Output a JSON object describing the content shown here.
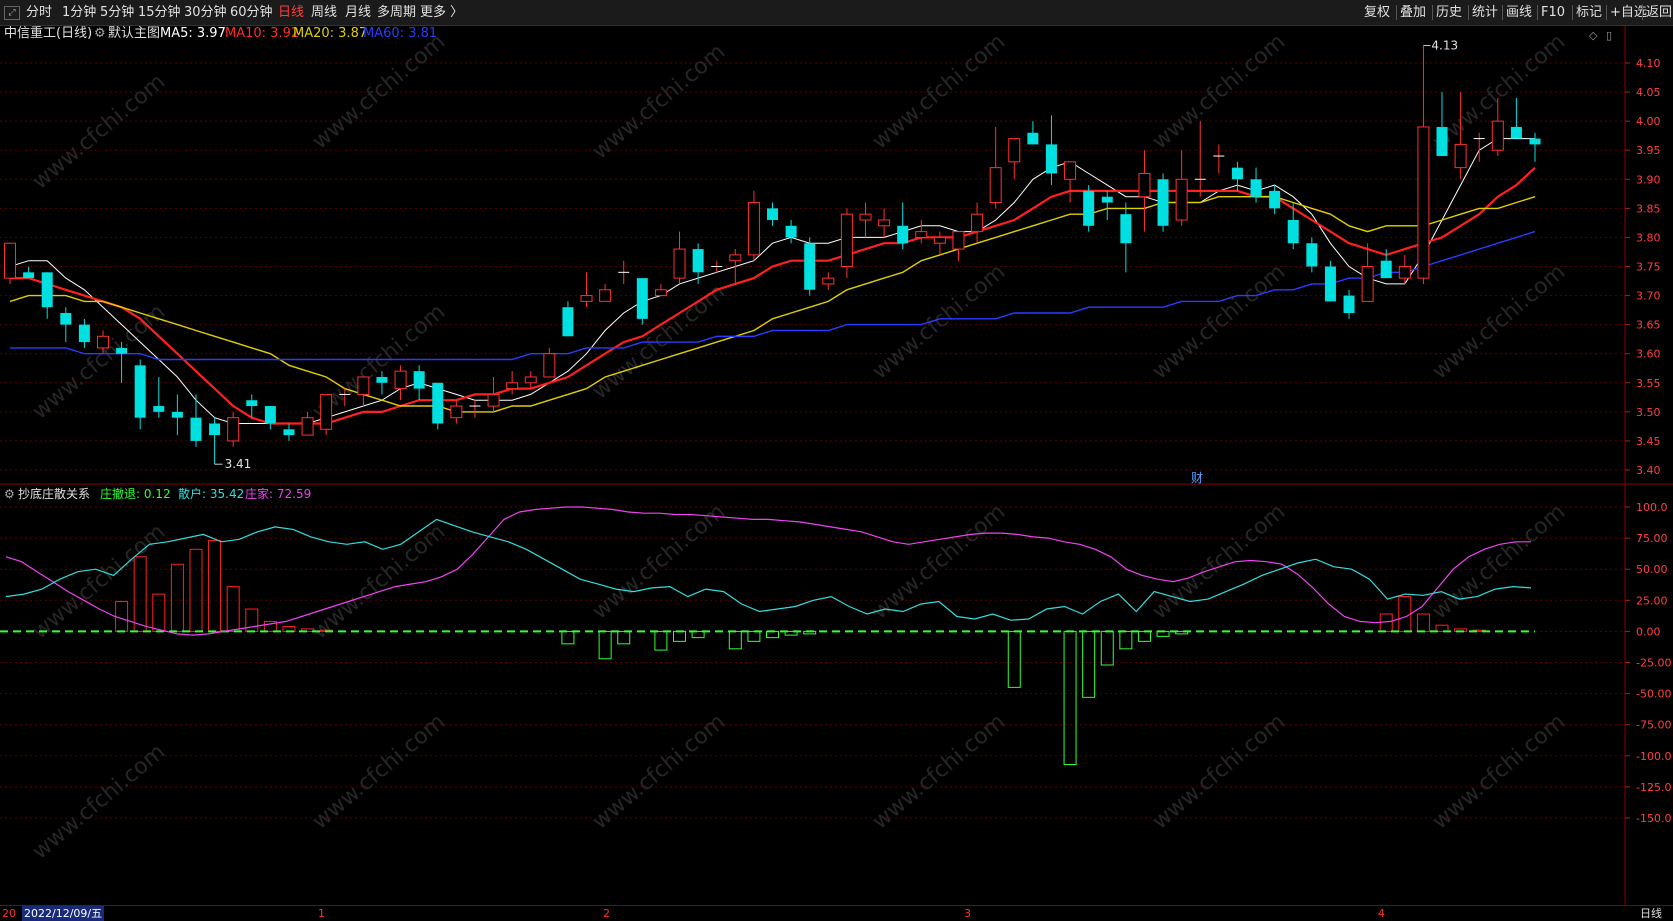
{
  "toolbar": {
    "left_items": [
      "分时",
      "1分钟",
      "5分钟",
      "15分钟",
      "30分钟",
      "60分钟",
      "日线",
      "周线",
      "月线",
      "多周期",
      "更多 〉"
    ],
    "active_index": 6,
    "right_items": [
      "复权",
      "叠加",
      "历史",
      "统计",
      "画线",
      "F10",
      "标记",
      "+自选",
      "返回"
    ]
  },
  "main": {
    "title": "中信重工(日线)",
    "template": "默认主图",
    "ma": [
      {
        "label": "MA5: 3.97",
        "color": "#ffffff"
      },
      {
        "label": "MA10: 3.92",
        "color": "#ff2a2a"
      },
      {
        "label": "MA20: 3.87",
        "color": "#e0d000"
      },
      {
        "label": "MA60: 3.81",
        "color": "#2a3cff"
      }
    ],
    "high_label": "4.13",
    "low_label": "3.41",
    "marker": "财"
  },
  "indicator": {
    "title": "抄底庄散关系",
    "values": [
      {
        "label": "庄撤退: 0.12",
        "color": "#33ff33"
      },
      {
        "label": "散户: 35.42",
        "color": "#33dddd"
      },
      {
        "label": "庄家: 72.59",
        "color": "#ee44ee"
      }
    ]
  },
  "footer": {
    "prefix": "20",
    "date": "2022/12/09/五",
    "months": [
      "1",
      "2",
      "3",
      "4"
    ],
    "period": "日线"
  },
  "watermark": "www.cfchi.com",
  "chart_data": {
    "type": "candlestick",
    "price_axis": {
      "min": 3.4,
      "max": 4.1,
      "ticks": [
        "4.10",
        "4.05",
        "4.00",
        "3.95",
        "3.90",
        "3.85",
        "3.80",
        "3.75",
        "3.70",
        "3.65",
        "3.60",
        "3.55",
        "3.50",
        "3.45",
        "3.40"
      ]
    },
    "indicator_axis": {
      "min": -150,
      "max": 100,
      "ticks": [
        "100.0",
        "75.00",
        "50.00",
        "25.00",
        "0.00",
        "-25.00",
        "-50.00",
        "-75.00",
        "-100.0",
        "-125.0",
        "-150.0"
      ]
    },
    "candles": [
      [
        3.73,
        3.79,
        3.72,
        3.79
      ],
      [
        3.74,
        3.75,
        3.73,
        3.73
      ],
      [
        3.74,
        3.74,
        3.66,
        3.68
      ],
      [
        3.67,
        3.68,
        3.62,
        3.65
      ],
      [
        3.65,
        3.66,
        3.61,
        3.62
      ],
      [
        3.61,
        3.64,
        3.6,
        3.63
      ],
      [
        3.61,
        3.62,
        3.55,
        3.6
      ],
      [
        3.58,
        3.59,
        3.47,
        3.49
      ],
      [
        3.51,
        3.56,
        3.49,
        3.5
      ],
      [
        3.5,
        3.53,
        3.46,
        3.49
      ],
      [
        3.49,
        3.53,
        3.44,
        3.45
      ],
      [
        3.48,
        3.49,
        3.41,
        3.46
      ],
      [
        3.45,
        3.5,
        3.44,
        3.49
      ],
      [
        3.52,
        3.53,
        3.49,
        3.51
      ],
      [
        3.51,
        3.51,
        3.47,
        3.48
      ],
      [
        3.47,
        3.48,
        3.45,
        3.46
      ],
      [
        3.46,
        3.5,
        3.46,
        3.49
      ],
      [
        3.47,
        3.53,
        3.46,
        3.53
      ],
      [
        3.53,
        3.54,
        3.51,
        3.53
      ],
      [
        3.53,
        3.56,
        3.51,
        3.56
      ],
      [
        3.56,
        3.57,
        3.53,
        3.55
      ],
      [
        3.54,
        3.58,
        3.52,
        3.57
      ],
      [
        3.57,
        3.58,
        3.52,
        3.54
      ],
      [
        3.55,
        3.55,
        3.47,
        3.48
      ],
      [
        3.49,
        3.52,
        3.48,
        3.51
      ],
      [
        3.51,
        3.52,
        3.49,
        3.51
      ],
      [
        3.51,
        3.56,
        3.5,
        3.53
      ],
      [
        3.54,
        3.57,
        3.53,
        3.55
      ],
      [
        3.55,
        3.57,
        3.54,
        3.56
      ],
      [
        3.56,
        3.61,
        3.56,
        3.6
      ],
      [
        3.68,
        3.69,
        3.63,
        3.63
      ],
      [
        3.69,
        3.74,
        3.68,
        3.7
      ],
      [
        3.69,
        3.72,
        3.69,
        3.71
      ],
      [
        3.74,
        3.76,
        3.72,
        3.74
      ],
      [
        3.73,
        3.73,
        3.65,
        3.66
      ],
      [
        3.7,
        3.72,
        3.7,
        3.71
      ],
      [
        3.73,
        3.81,
        3.72,
        3.78
      ],
      [
        3.78,
        3.79,
        3.72,
        3.74
      ],
      [
        3.75,
        3.76,
        3.74,
        3.75
      ],
      [
        3.76,
        3.78,
        3.72,
        3.77
      ],
      [
        3.77,
        3.88,
        3.76,
        3.86
      ],
      [
        3.85,
        3.86,
        3.82,
        3.83
      ],
      [
        3.82,
        3.83,
        3.79,
        3.8
      ],
      [
        3.79,
        3.8,
        3.7,
        3.71
      ],
      [
        3.72,
        3.74,
        3.71,
        3.73
      ],
      [
        3.75,
        3.85,
        3.73,
        3.84
      ],
      [
        3.83,
        3.86,
        3.8,
        3.84
      ],
      [
        3.82,
        3.85,
        3.8,
        3.83
      ],
      [
        3.82,
        3.86,
        3.78,
        3.79
      ],
      [
        3.8,
        3.83,
        3.79,
        3.81
      ],
      [
        3.79,
        3.81,
        3.77,
        3.8
      ],
      [
        3.78,
        3.81,
        3.76,
        3.81
      ],
      [
        3.81,
        3.86,
        3.79,
        3.84
      ],
      [
        3.86,
        3.99,
        3.85,
        3.92
      ],
      [
        3.93,
        3.97,
        3.9,
        3.97
      ],
      [
        3.98,
        4.0,
        3.96,
        3.96
      ],
      [
        3.96,
        4.01,
        3.89,
        3.91
      ],
      [
        3.9,
        3.93,
        3.86,
        3.93
      ],
      [
        3.88,
        3.89,
        3.81,
        3.82
      ],
      [
        3.87,
        3.88,
        3.83,
        3.86
      ],
      [
        3.84,
        3.86,
        3.74,
        3.79
      ],
      [
        3.87,
        3.95,
        3.81,
        3.91
      ],
      [
        3.9,
        3.91,
        3.81,
        3.82
      ],
      [
        3.83,
        3.95,
        3.82,
        3.9
      ],
      [
        3.9,
        4.0,
        3.87,
        3.9
      ],
      [
        3.94,
        3.96,
        3.91,
        3.94
      ],
      [
        3.92,
        3.93,
        3.88,
        3.9
      ],
      [
        3.9,
        3.92,
        3.86,
        3.87
      ],
      [
        3.88,
        3.89,
        3.84,
        3.85
      ],
      [
        3.83,
        3.86,
        3.78,
        3.79
      ],
      [
        3.79,
        3.8,
        3.74,
        3.75
      ],
      [
        3.75,
        3.76,
        3.69,
        3.69
      ],
      [
        3.7,
        3.71,
        3.66,
        3.67
      ],
      [
        3.69,
        3.79,
        3.69,
        3.75
      ],
      [
        3.76,
        3.78,
        3.73,
        3.73
      ],
      [
        3.73,
        3.77,
        3.72,
        3.75
      ],
      [
        3.73,
        4.13,
        3.72,
        3.99
      ],
      [
        3.99,
        4.05,
        3.94,
        3.94
      ],
      [
        3.92,
        4.05,
        3.9,
        3.96
      ],
      [
        3.97,
        3.98,
        3.93,
        3.97
      ],
      [
        3.95,
        4.04,
        3.94,
        4.0
      ],
      [
        3.99,
        4.04,
        3.97,
        3.97
      ],
      [
        3.97,
        3.98,
        3.93,
        3.96
      ]
    ],
    "series": [
      {
        "name": "MA5",
        "values": [
          3.75,
          3.76,
          3.76,
          3.73,
          3.71,
          3.68,
          3.65,
          3.62,
          3.59,
          3.56,
          3.52,
          3.49,
          3.48,
          3.48,
          3.48,
          3.48,
          3.48,
          3.49,
          3.5,
          3.51,
          3.52,
          3.54,
          3.55,
          3.54,
          3.53,
          3.52,
          3.52,
          3.52,
          3.53,
          3.55,
          3.57,
          3.6,
          3.64,
          3.67,
          3.69,
          3.7,
          3.72,
          3.73,
          3.74,
          3.75,
          3.76,
          3.79,
          3.8,
          3.79,
          3.79,
          3.8,
          3.8,
          3.8,
          3.81,
          3.82,
          3.82,
          3.81,
          3.81,
          3.83,
          3.86,
          3.9,
          3.92,
          3.93,
          3.91,
          3.89,
          3.87,
          3.87,
          3.86,
          3.86,
          3.86,
          3.88,
          3.89,
          3.88,
          3.89,
          3.87,
          3.84,
          3.79,
          3.75,
          3.73,
          3.72,
          3.72,
          3.77,
          3.83,
          3.89,
          3.95,
          3.97,
          3.97,
          3.97
        ]
      },
      {
        "name": "MA10",
        "values": [
          3.73,
          3.73,
          3.72,
          3.71,
          3.7,
          3.69,
          3.68,
          3.66,
          3.63,
          3.6,
          3.57,
          3.54,
          3.51,
          3.49,
          3.48,
          3.48,
          3.48,
          3.48,
          3.49,
          3.5,
          3.5,
          3.51,
          3.52,
          3.52,
          3.52,
          3.53,
          3.53,
          3.54,
          3.54,
          3.55,
          3.56,
          3.58,
          3.6,
          3.62,
          3.63,
          3.65,
          3.67,
          3.69,
          3.71,
          3.72,
          3.73,
          3.75,
          3.76,
          3.76,
          3.76,
          3.77,
          3.78,
          3.79,
          3.79,
          3.8,
          3.8,
          3.8,
          3.81,
          3.82,
          3.83,
          3.85,
          3.87,
          3.88,
          3.88,
          3.88,
          3.88,
          3.88,
          3.88,
          3.88,
          3.88,
          3.88,
          3.88,
          3.87,
          3.87,
          3.85,
          3.83,
          3.81,
          3.79,
          3.78,
          3.77,
          3.78,
          3.79,
          3.8,
          3.82,
          3.84,
          3.87,
          3.89,
          3.92
        ]
      },
      {
        "name": "MA20",
        "values": [
          3.69,
          3.7,
          3.7,
          3.7,
          3.69,
          3.69,
          3.68,
          3.67,
          3.66,
          3.65,
          3.64,
          3.63,
          3.62,
          3.61,
          3.6,
          3.58,
          3.57,
          3.56,
          3.54,
          3.53,
          3.52,
          3.51,
          3.51,
          3.51,
          3.5,
          3.5,
          3.5,
          3.51,
          3.51,
          3.52,
          3.53,
          3.54,
          3.56,
          3.57,
          3.58,
          3.59,
          3.6,
          3.61,
          3.62,
          3.63,
          3.64,
          3.66,
          3.67,
          3.68,
          3.69,
          3.71,
          3.72,
          3.73,
          3.74,
          3.76,
          3.77,
          3.78,
          3.79,
          3.8,
          3.81,
          3.82,
          3.83,
          3.84,
          3.84,
          3.85,
          3.85,
          3.85,
          3.86,
          3.86,
          3.86,
          3.87,
          3.87,
          3.87,
          3.87,
          3.86,
          3.85,
          3.84,
          3.82,
          3.81,
          3.82,
          3.82,
          3.82,
          3.83,
          3.84,
          3.85,
          3.85,
          3.86,
          3.87
        ]
      },
      {
        "name": "MA60",
        "values": [
          3.61,
          3.61,
          3.61,
          3.61,
          3.6,
          3.6,
          3.6,
          3.6,
          3.59,
          3.59,
          3.59,
          3.59,
          3.59,
          3.59,
          3.59,
          3.59,
          3.59,
          3.59,
          3.59,
          3.59,
          3.59,
          3.59,
          3.59,
          3.59,
          3.59,
          3.59,
          3.59,
          3.59,
          3.6,
          3.6,
          3.6,
          3.61,
          3.61,
          3.61,
          3.62,
          3.62,
          3.62,
          3.62,
          3.63,
          3.63,
          3.63,
          3.64,
          3.64,
          3.64,
          3.64,
          3.65,
          3.65,
          3.65,
          3.65,
          3.65,
          3.66,
          3.66,
          3.66,
          3.66,
          3.67,
          3.67,
          3.67,
          3.67,
          3.68,
          3.68,
          3.68,
          3.68,
          3.68,
          3.69,
          3.69,
          3.69,
          3.7,
          3.7,
          3.71,
          3.71,
          3.72,
          3.72,
          3.73,
          3.73,
          3.74,
          3.74,
          3.75,
          3.76,
          3.77,
          3.78,
          3.79,
          3.8,
          3.81
        ]
      }
    ],
    "indicator_series": [
      {
        "name": "庄家",
        "values": [
          60,
          56,
          48,
          40,
          32,
          25,
          18,
          12,
          8,
          4,
          1,
          -2,
          -3,
          -2,
          0,
          2,
          4,
          6,
          8,
          12,
          16,
          20,
          24,
          28,
          32,
          36,
          38,
          40,
          44,
          50,
          62,
          76,
          90,
          96,
          98,
          99,
          100,
          100,
          99,
          98,
          96,
          95,
          95,
          94,
          94,
          93,
          92,
          91,
          90,
          90,
          89,
          88,
          86,
          84,
          82,
          80,
          76,
          72,
          70,
          72,
          74,
          76,
          78,
          79,
          79,
          78,
          76,
          75,
          72,
          70,
          66,
          60,
          50,
          45,
          42,
          40,
          43,
          48,
          52,
          56,
          57,
          56,
          54,
          46,
          35,
          22,
          12,
          8,
          7,
          8,
          12,
          20,
          35,
          50,
          60,
          66,
          70,
          72,
          72
        ]
      },
      {
        "name": "散户",
        "values": [
          28,
          30,
          34,
          42,
          48,
          50,
          45,
          58,
          70,
          72,
          75,
          78,
          72,
          74,
          80,
          84,
          82,
          76,
          72,
          70,
          72,
          66,
          70,
          80,
          90,
          85,
          80,
          76,
          72,
          66,
          58,
          50,
          42,
          38,
          34,
          32,
          35,
          36,
          28,
          34,
          32,
          22,
          16,
          18,
          20,
          25,
          28,
          20,
          14,
          18,
          16,
          22,
          24,
          12,
          10,
          14,
          9,
          10,
          18,
          20,
          14,
          24,
          30,
          16,
          32,
          28,
          24,
          26,
          32,
          38,
          45,
          50,
          55,
          58,
          52,
          50,
          42,
          26,
          30,
          29,
          32,
          26,
          28,
          34,
          36,
          35
        ]
      },
      {
        "name": "庄撤退",
        "values": [
          0,
          0,
          0,
          0,
          0,
          0,
          0,
          0,
          0,
          0,
          0,
          0,
          0,
          0,
          0,
          0,
          0,
          0,
          0,
          0,
          0,
          0,
          0,
          0,
          0,
          0,
          0,
          0,
          0,
          0,
          -10,
          0,
          -22,
          -10,
          0,
          -15,
          -8,
          -5,
          0,
          -14,
          -8,
          -5,
          -3,
          -2,
          0,
          0,
          0,
          0,
          0,
          0,
          0,
          0,
          0,
          0,
          -45,
          0,
          0,
          -107,
          -53,
          -27,
          -14,
          -8,
          -4,
          -2,
          0,
          0,
          0,
          0,
          0,
          0,
          0,
          0,
          0,
          0,
          0,
          0,
          0,
          0,
          0,
          0,
          0,
          0,
          0
        ]
      },
      {
        "name": "red_bars",
        "values": [
          0,
          0,
          0,
          0,
          0,
          0,
          24,
          60,
          30,
          54,
          66,
          73,
          36,
          18,
          8,
          4,
          2,
          1,
          0,
          0,
          0,
          0,
          0,
          0,
          0,
          0,
          0,
          0,
          0,
          0,
          0,
          0,
          0,
          0,
          0,
          0,
          0,
          0,
          0,
          0,
          0,
          0,
          0,
          0,
          0,
          0,
          0,
          0,
          0,
          0,
          0,
          0,
          0,
          0,
          0,
          0,
          0,
          0,
          0,
          0,
          0,
          0,
          0,
          0,
          0,
          0,
          0,
          0,
          0,
          0,
          0,
          0,
          0,
          0,
          14,
          28,
          14,
          5,
          2,
          1,
          0,
          0,
          0
        ]
      }
    ]
  }
}
